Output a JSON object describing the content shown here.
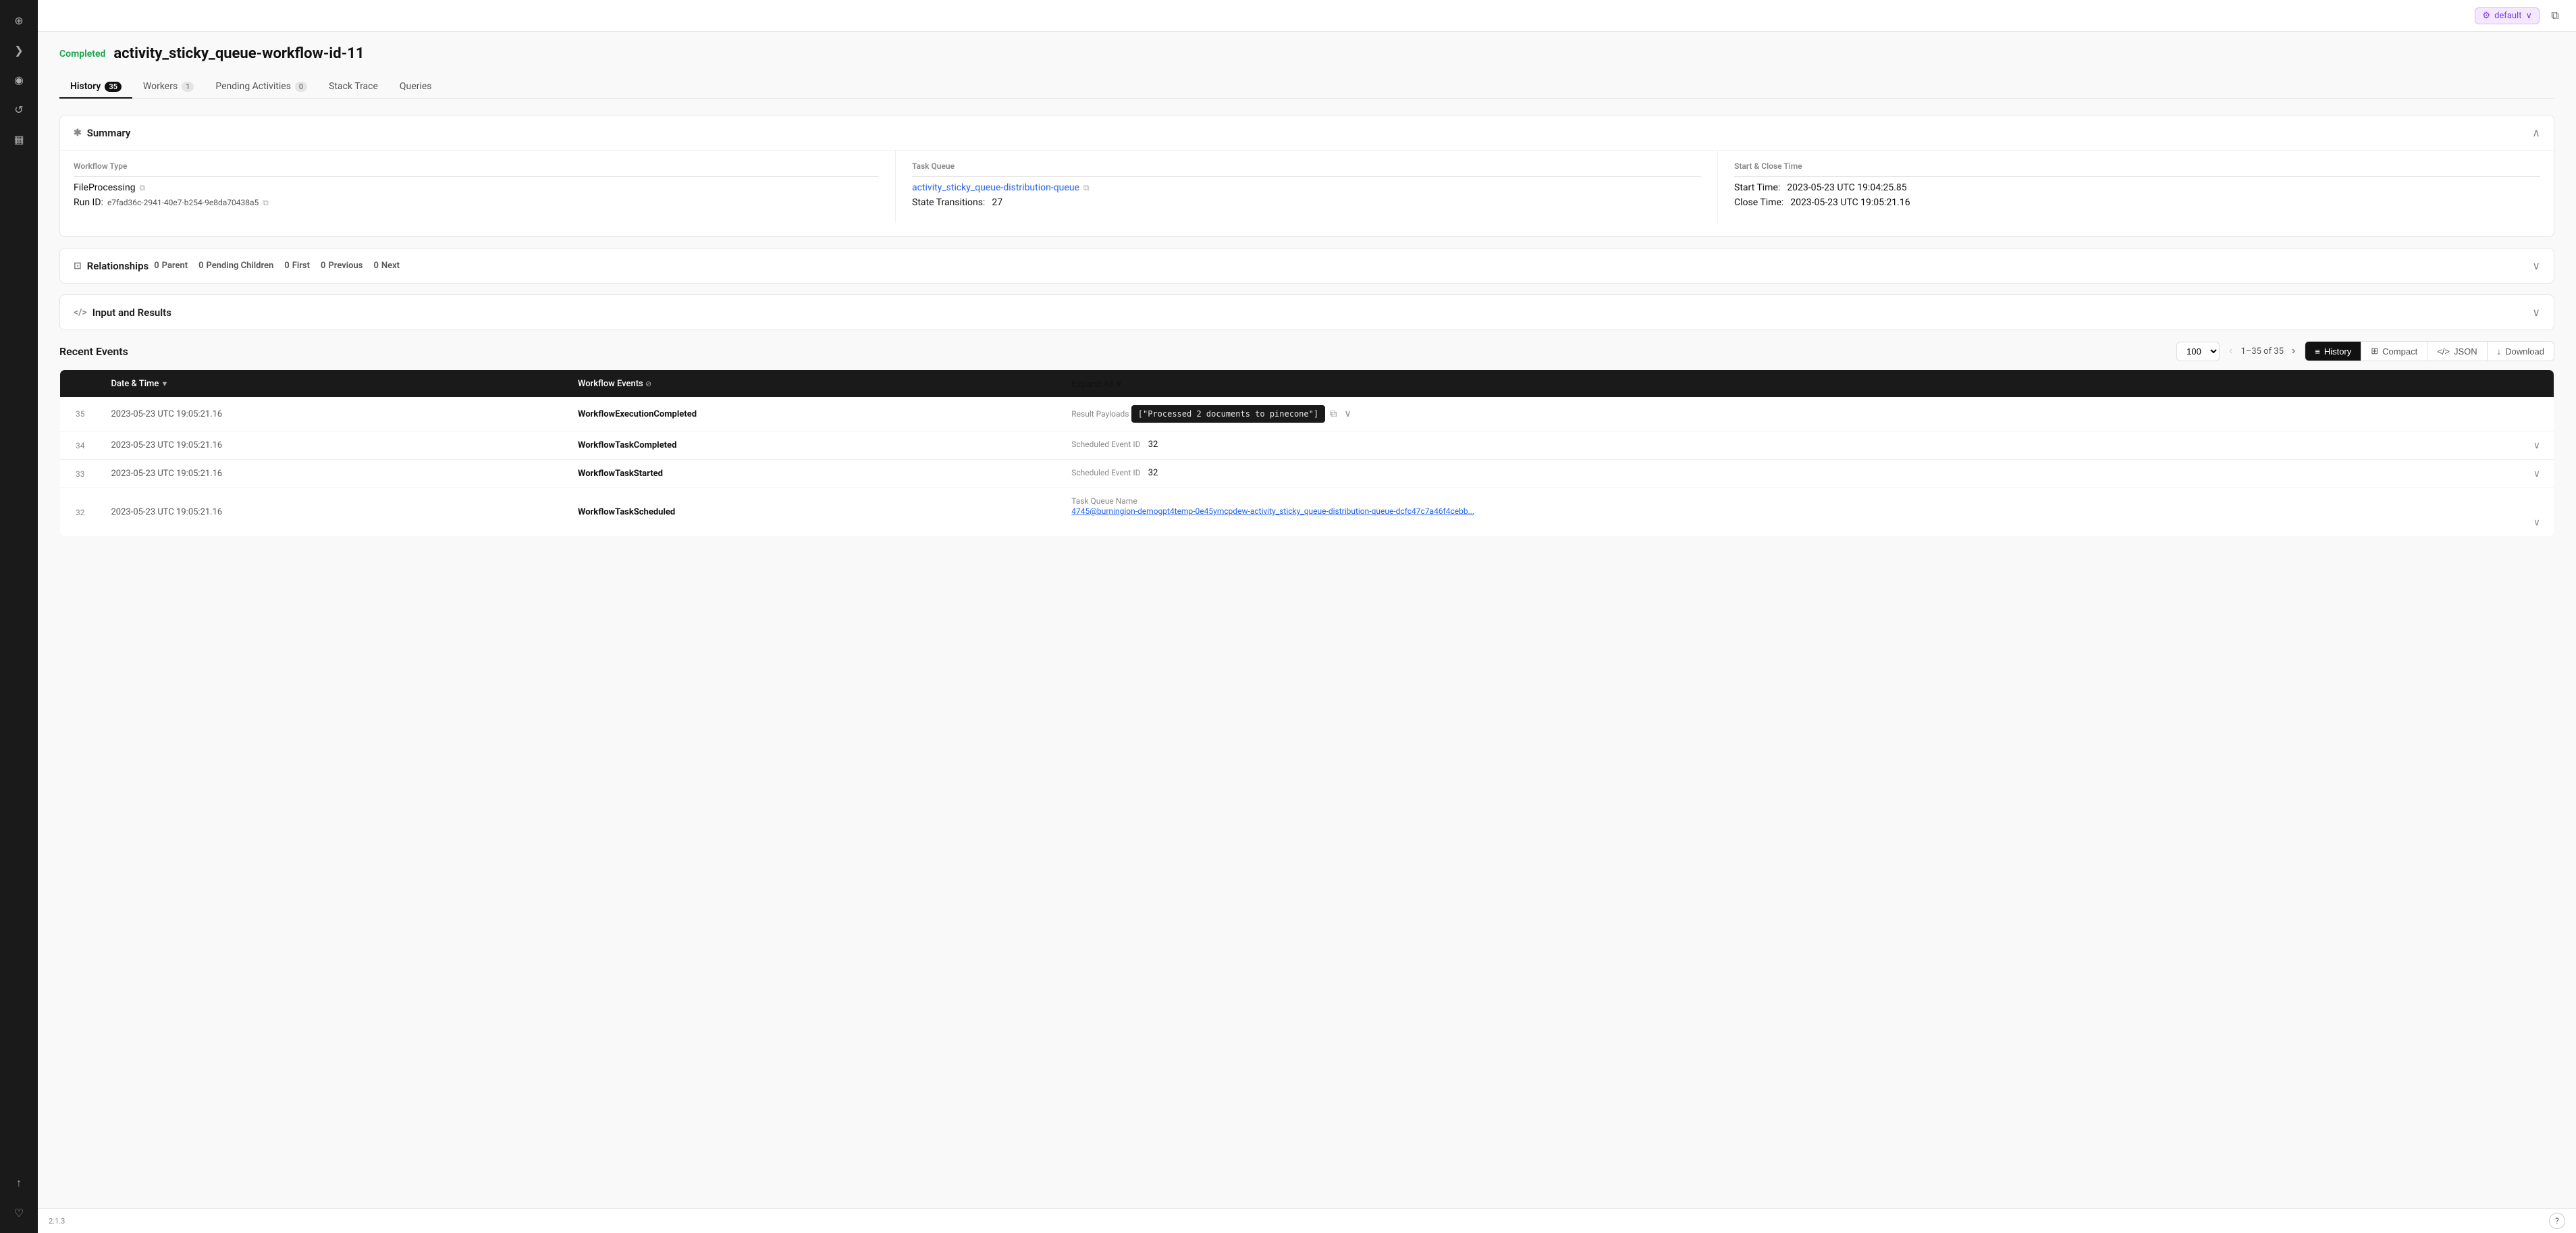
{
  "sidebar": {
    "icons": [
      {
        "name": "home-icon",
        "glyph": "⊕",
        "active": false
      },
      {
        "name": "nav-down-icon",
        "glyph": "›",
        "active": false
      },
      {
        "name": "activity-icon",
        "glyph": "◎",
        "active": false
      },
      {
        "name": "workflows-icon",
        "glyph": "⟳",
        "active": false
      },
      {
        "name": "archive-icon",
        "glyph": "▣",
        "active": false
      }
    ],
    "bottom_icons": [
      {
        "name": "upload-icon",
        "glyph": "↑"
      },
      {
        "name": "favorite-icon",
        "glyph": "♡"
      }
    ]
  },
  "topbar": {
    "namespace_label": "default",
    "namespace_icon": "⚙",
    "copy_icon": "⧉"
  },
  "page": {
    "status": "Completed",
    "title": "activity_sticky_queue-workflow-id-11"
  },
  "tabs": [
    {
      "label": "History",
      "badge": "35",
      "active": true
    },
    {
      "label": "Workers",
      "badge": "1",
      "active": false
    },
    {
      "label": "Pending Activities",
      "badge": "0",
      "active": false
    },
    {
      "label": "Stack Trace",
      "badge": null,
      "active": false
    },
    {
      "label": "Queries",
      "badge": null,
      "active": false
    }
  ],
  "summary": {
    "title": "Summary",
    "workflow_type_label": "Workflow Type",
    "workflow_type_value": "FileProcessing",
    "run_id_label": "Run ID",
    "run_id_value": "e7fad36c-2941-40e7-b254-9e8da70438a5",
    "task_queue_label": "Task Queue",
    "task_queue_value": "activity_sticky_queue-distribution-queue",
    "state_transitions_label": "State Transitions:",
    "state_transitions_value": "27",
    "start_close_time_label": "Start & Close Time",
    "start_time_label": "Start Time:",
    "start_time_value": "2023-05-23 UTC 19:04:25.85",
    "close_time_label": "Close Time:",
    "close_time_value": "2023-05-23 UTC 19:05:21.16"
  },
  "relationships": {
    "title": "Relationships",
    "parent_count": "0",
    "parent_label": "Parent",
    "pending_children_count": "0",
    "pending_children_label": "Pending Children",
    "first_count": "0",
    "first_label": "First",
    "previous_count": "0",
    "previous_label": "Previous",
    "next_count": "0",
    "next_label": "Next"
  },
  "input_results": {
    "title": "Input and Results"
  },
  "recent_events": {
    "title": "Recent Events",
    "page_size": "100",
    "pagination_text": "1–35 of 35",
    "view_buttons": [
      {
        "label": "History",
        "icon": "≡",
        "active": true
      },
      {
        "label": "Compact",
        "icon": "⊞",
        "active": false
      },
      {
        "label": "JSON",
        "icon": "</>",
        "active": false
      },
      {
        "label": "Download",
        "icon": "↓",
        "active": false
      }
    ],
    "expand_all_label": "Expand All",
    "columns": [
      {
        "label": "",
        "key": "number"
      },
      {
        "label": "Date & Time",
        "key": "datetime",
        "sortable": true
      },
      {
        "label": "Workflow Events",
        "key": "event",
        "filterable": true
      },
      {
        "label": "",
        "key": "detail"
      }
    ],
    "rows": [
      {
        "number": "35",
        "datetime": "2023-05-23 UTC 19:05:21.16",
        "event": "WorkflowExecutionCompleted",
        "detail_label": "Result Payloads",
        "detail_value": "[\"Processed 2 documents to pinecone\"]",
        "detail_is_payload": true,
        "detail_extra": null
      },
      {
        "number": "34",
        "datetime": "2023-05-23 UTC 19:05:21.16",
        "event": "WorkflowTaskCompleted",
        "detail_label": "Scheduled Event ID",
        "detail_value": "32",
        "detail_is_payload": false,
        "detail_extra": null
      },
      {
        "number": "33",
        "datetime": "2023-05-23 UTC 19:05:21.16",
        "event": "WorkflowTaskStarted",
        "detail_label": "Scheduled Event ID",
        "detail_value": "32",
        "detail_is_payload": false,
        "detail_extra": null
      },
      {
        "number": "32",
        "datetime": "2023-05-23 UTC 19:05:21.16",
        "event": "WorkflowTaskScheduled",
        "detail_label": "Task Queue Name",
        "detail_value": "4745@burningion-demogpt4temp-0e45ymcpdew-activity_sticky_queue-distribution-queue-dcfc47c7a46f4cebb...",
        "detail_is_payload": false,
        "detail_extra": null,
        "detail_is_link": true
      }
    ]
  },
  "bottom_bar": {
    "version": "2.1.3",
    "help_label": "?"
  }
}
